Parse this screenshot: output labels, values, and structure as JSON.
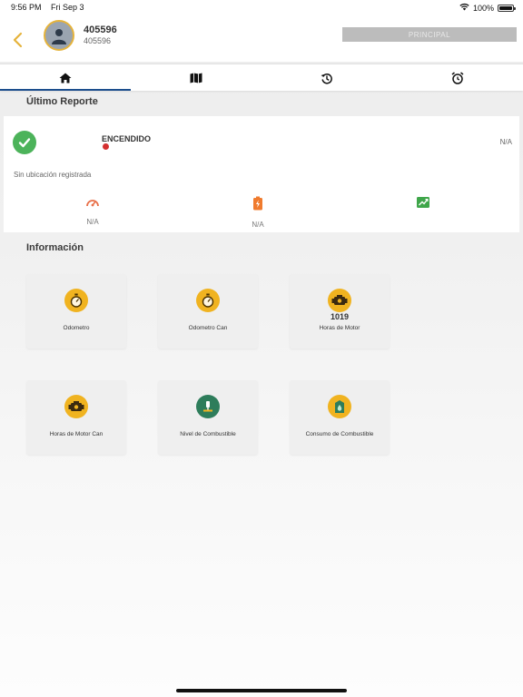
{
  "status_bar": {
    "time": "9:56 PM",
    "date": "Fri Sep 3",
    "battery": "100%"
  },
  "header": {
    "title": "405596",
    "subtitle": "405596",
    "principal_label": "PRINCIPAL",
    "accent": "#e5b33c"
  },
  "tabs": [
    {
      "icon": "home-icon",
      "active": true
    },
    {
      "icon": "map-icon",
      "active": false
    },
    {
      "icon": "history-icon",
      "active": false
    },
    {
      "icon": "alarm-icon",
      "active": false
    }
  ],
  "report": {
    "section_title": "Último Reporte",
    "status": "ENCENDIDO",
    "right_value": "N/A",
    "location": "Sin ubicación registrada",
    "metrics": [
      {
        "icon": "speedometer-icon",
        "value": "N/A"
      },
      {
        "icon": "battery-icon",
        "value": "N/A"
      },
      {
        "icon": "signal-icon",
        "value": ""
      }
    ]
  },
  "info": {
    "section_title": "Información",
    "tiles": [
      {
        "icon": "stopwatch-icon",
        "value": "",
        "label": "Odometro"
      },
      {
        "icon": "stopwatch-icon",
        "value": "",
        "label": "Odometro Can"
      },
      {
        "icon": "engine-icon",
        "value": "1019",
        "label": "Horas de Motor"
      },
      {
        "icon": "engine-icon",
        "value": "",
        "label": "Horas de Motor Can"
      },
      {
        "icon": "fuel-level-icon",
        "value": "",
        "label": "Nivel de Combustible"
      },
      {
        "icon": "fuel-consumption-icon",
        "value": "",
        "label": "Consumo de Combustible"
      }
    ]
  }
}
